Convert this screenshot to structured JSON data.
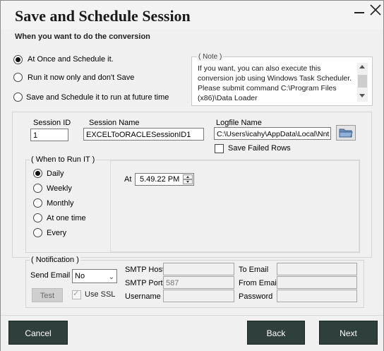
{
  "window": {
    "title": "Save and Schedule Session",
    "subtitle": "When you want to do the conversion"
  },
  "mode_options": [
    {
      "label": "At Once and Schedule it.",
      "checked": true
    },
    {
      "label": "Run it now only and don't Save",
      "checked": false
    },
    {
      "label": "Save and Schedule it to run at future time",
      "checked": false
    }
  ],
  "note": {
    "legend": "( Note )",
    "text": "If you want, you can also execute this conversion job using Windows Task Scheduler. Please submit command C:\\Program Files (x86)\\Data Loader"
  },
  "session": {
    "id_label": "Session ID",
    "id_value": "1",
    "name_label": "Session Name",
    "name_value": "EXCELToORACLESessionID1",
    "logfile_label": "Logfile Name",
    "logfile_value": "C:\\Users\\icahy\\AppData\\Local\\Nnt",
    "save_failed_label": "Save Failed Rows",
    "save_failed_checked": false
  },
  "schedule": {
    "legend": "( When to Run IT )",
    "options": [
      {
        "label": "Daily",
        "checked": true
      },
      {
        "label": "Weekly",
        "checked": false
      },
      {
        "label": "Monthly",
        "checked": false
      },
      {
        "label": "At one time",
        "checked": false
      },
      {
        "label": "Every",
        "checked": false
      }
    ],
    "at_label": "At",
    "time_value": "5.49.22 PM"
  },
  "notification": {
    "legend": "( Notification )",
    "send_email_label": "Send Email",
    "send_email_value": "No",
    "test_label": "Test",
    "use_ssl_label": "Use SSL",
    "use_ssl_checked": true,
    "smtp_host_label": "SMTP Host",
    "smtp_host_value": "",
    "smtp_port_label": "SMTP Port",
    "smtp_port_value": "587",
    "username_label": "Username",
    "username_value": "",
    "to_email_label": "To Email",
    "to_email_value": "",
    "from_email_label": "From Email",
    "from_email_value": "",
    "password_label": "Password",
    "password_value": ""
  },
  "buttons": {
    "cancel": "Cancel",
    "back": "Back",
    "next": "Next"
  },
  "colors": {
    "dark_button": "#2f3f3b",
    "window_bg": "#f0f0f0"
  }
}
